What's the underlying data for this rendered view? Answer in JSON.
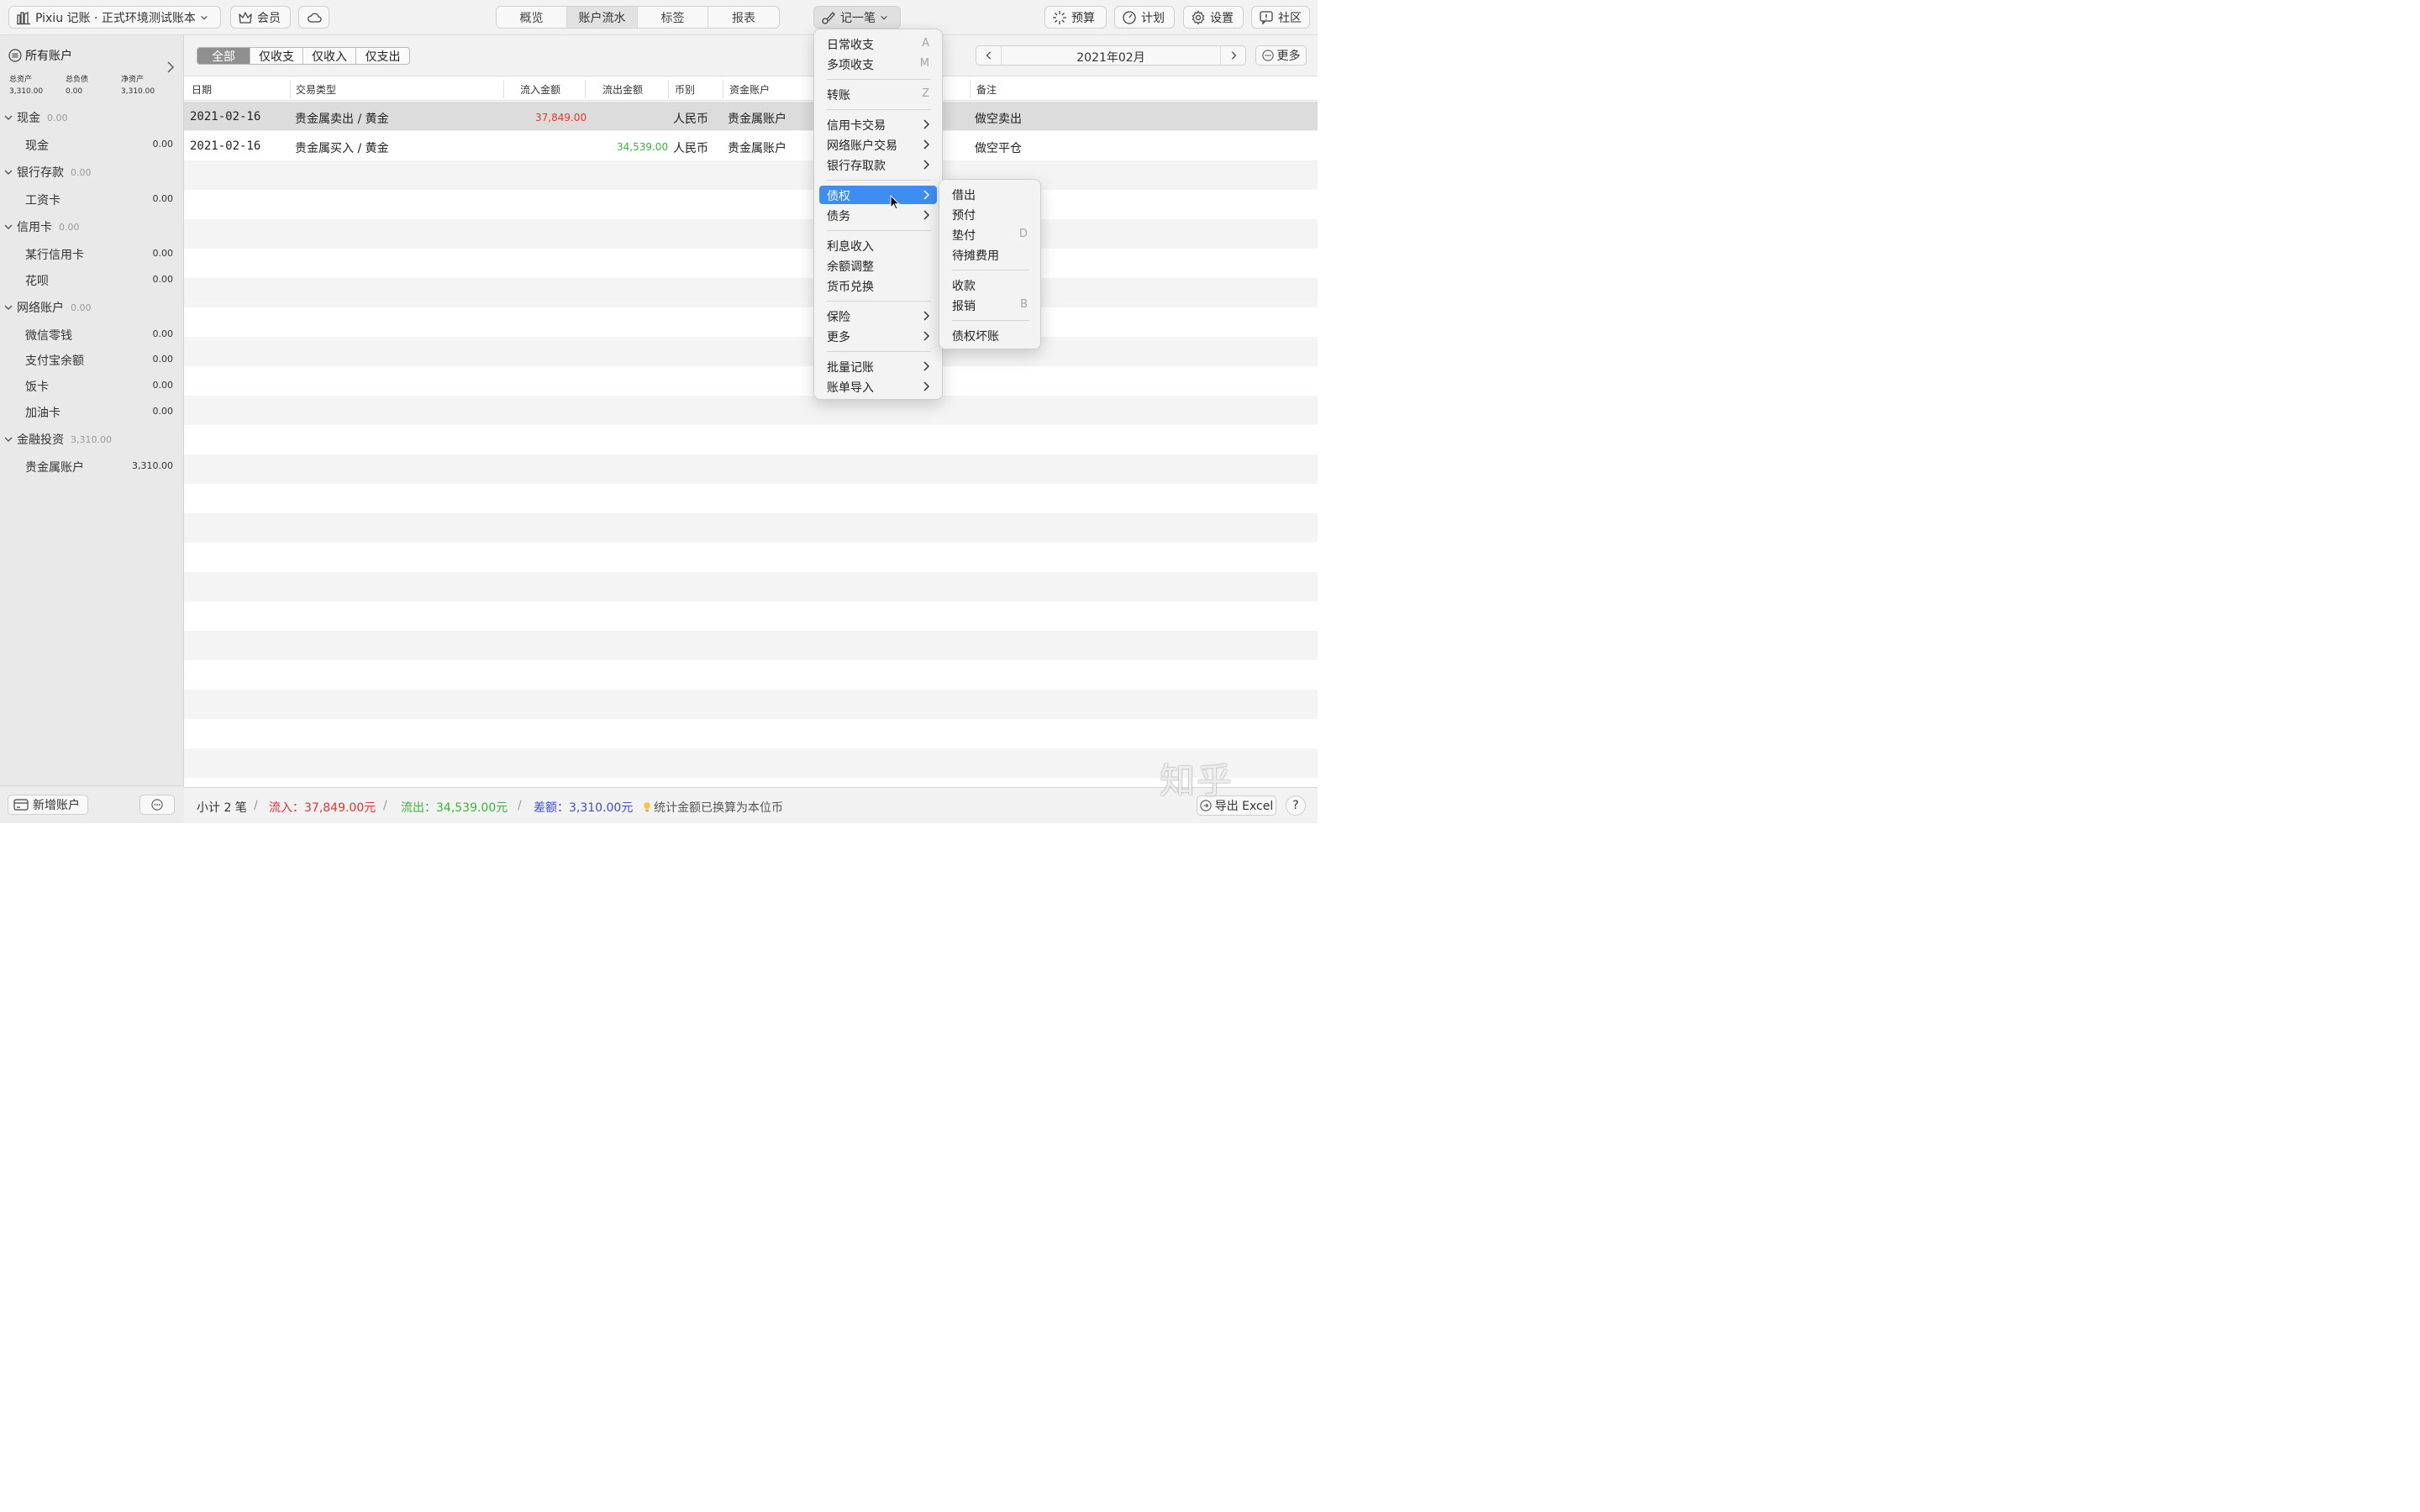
{
  "toolbar": {
    "book_title": "Pixiu 记账 · 正式环境测试账本",
    "member": "会员",
    "tabs": [
      "概览",
      "账户流水",
      "标签",
      "报表"
    ],
    "record_button": "记一笔",
    "budget": "预算",
    "plan": "计划",
    "settings": "设置",
    "community": "社区"
  },
  "sidebar": {
    "title": "所有账户",
    "stats": [
      {
        "label": "总资产",
        "value": "3,310.00"
      },
      {
        "label": "总负债",
        "value": "0.00"
      },
      {
        "label": "净资产",
        "value": "3,310.00"
      }
    ],
    "groups": [
      {
        "name": "现金",
        "value": "0.00",
        "items": [
          {
            "name": "现金",
            "value": "0.00"
          }
        ]
      },
      {
        "name": "银行存款",
        "value": "0.00",
        "items": [
          {
            "name": "工资卡",
            "value": "0.00"
          }
        ]
      },
      {
        "name": "信用卡",
        "value": "0.00",
        "items": [
          {
            "name": "某行信用卡",
            "value": "0.00"
          },
          {
            "name": "花呗",
            "value": "0.00"
          }
        ]
      },
      {
        "name": "网络账户",
        "value": "0.00",
        "items": [
          {
            "name": "微信零钱",
            "value": "0.00"
          },
          {
            "name": "支付宝余额",
            "value": "0.00"
          },
          {
            "name": "饭卡",
            "value": "0.00"
          },
          {
            "name": "加油卡",
            "value": "0.00"
          }
        ]
      },
      {
        "name": "金融投资",
        "value": "3,310.00",
        "items": [
          {
            "name": "贵金属账户",
            "value": "3,310.00"
          }
        ]
      }
    ],
    "add_account": "新增账户"
  },
  "filter": {
    "options": [
      "全部",
      "仅收支",
      "仅收入",
      "仅支出"
    ],
    "active_index": 0
  },
  "month": "2021年02月",
  "more": "更多",
  "table": {
    "headers": [
      "日期",
      "交易类型",
      "流入金额",
      "流出金额",
      "币别",
      "资金账户",
      "备注"
    ],
    "rows": [
      {
        "date": "2021-02-16",
        "type": "贵金属卖出 / 黄金",
        "inflow": "37,849.00",
        "outflow": "",
        "currency": "人民币",
        "account": "贵金属账户",
        "note": "做空卖出"
      },
      {
        "date": "2021-02-16",
        "type": "贵金属买入 / 黄金",
        "inflow": "",
        "outflow": "34,539.00",
        "currency": "人民币",
        "account": "贵金属账户",
        "note": "做空平仓"
      }
    ]
  },
  "footer": {
    "count": "小计 2 笔",
    "inflow_label": "流入：",
    "inflow": "37,849.00元",
    "outflow_label": "流出：",
    "outflow": "34,539.00元",
    "diff_label": "差额：",
    "diff": "3,310.00元",
    "note": "统计金额已换算为本位币",
    "export": "导出 Excel",
    "help": "?"
  },
  "record_menu": {
    "groups": [
      [
        {
          "label": "日常收支",
          "shortcut": "A"
        },
        {
          "label": "多项收支",
          "shortcut": "M"
        }
      ],
      [
        {
          "label": "转账",
          "shortcut": "Z"
        }
      ],
      [
        {
          "label": "信用卡交易",
          "submenu": true
        },
        {
          "label": "网络账户交易",
          "submenu": true
        },
        {
          "label": "银行存取款",
          "submenu": true
        }
      ],
      [
        {
          "label": "债权",
          "submenu": true,
          "highlighted": true
        },
        {
          "label": "债务",
          "submenu": true
        }
      ],
      [
        {
          "label": "利息收入"
        },
        {
          "label": "余额调整"
        },
        {
          "label": "货币兑换"
        }
      ],
      [
        {
          "label": "保险",
          "submenu": true
        },
        {
          "label": "更多",
          "submenu": true
        }
      ],
      [
        {
          "label": "批量记账",
          "submenu": true
        },
        {
          "label": "账单导入",
          "submenu": true
        }
      ]
    ]
  },
  "claim_submenu": {
    "groups": [
      [
        {
          "label": "借出"
        },
        {
          "label": "预付"
        },
        {
          "label": "垫付",
          "shortcut": "D"
        },
        {
          "label": "待摊费用"
        }
      ],
      [
        {
          "label": "收款"
        },
        {
          "label": "报销",
          "shortcut": "B"
        }
      ],
      [
        {
          "label": "债权坏账"
        }
      ]
    ]
  },
  "watermark": "知乎",
  "colors": {
    "inflow": "#e8322f",
    "outflow": "#3bb33b",
    "diff": "#3c4fd0",
    "highlight": "#3d8ef3"
  }
}
